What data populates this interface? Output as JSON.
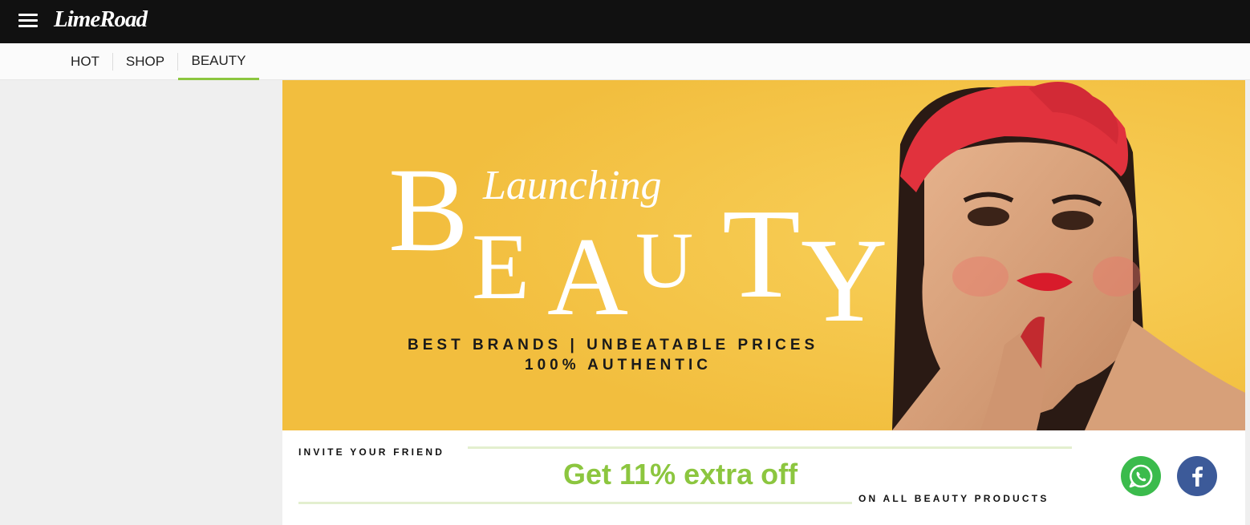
{
  "header": {
    "logo": "LimeRoad"
  },
  "tabs": [
    {
      "label": "HOT"
    },
    {
      "label": "SHOP"
    },
    {
      "label": "BEAUTY"
    }
  ],
  "hero": {
    "headline_script": "Launching",
    "headline_big": "BEAUTY",
    "tagline_1": "BEST BRANDS | UNBEATABLE PRICES",
    "tagline_2": "100% AUTHENTIC",
    "background_color": "#f4c343"
  },
  "invite": {
    "title": "INVITE YOUR FRIEND",
    "offer": "Get 11% extra off",
    "subline": "ON ALL BEAUTY PRODUCTS",
    "accent_color": "#8cc63f"
  },
  "share": {
    "whatsapp_icon": "whatsapp-icon",
    "facebook_icon": "facebook-icon"
  }
}
